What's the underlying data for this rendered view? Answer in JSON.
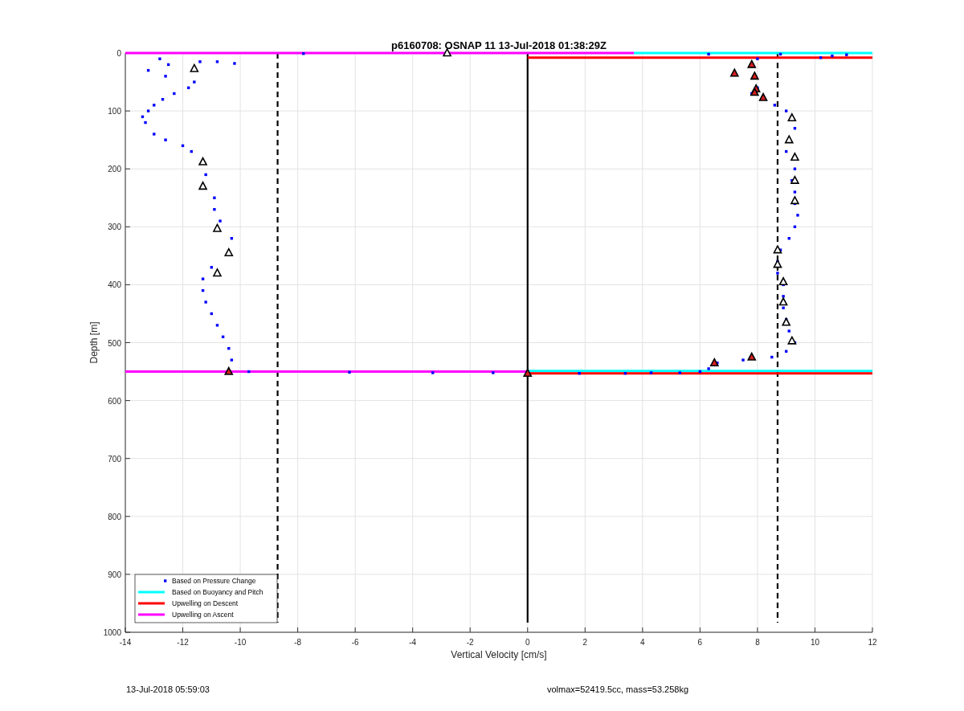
{
  "figure": {
    "chart_data": {
      "type": "scatter",
      "title": "p6160708: OSNAP 11 13-Jul-2018 01:38:29Z",
      "xlabel": "Vertical Velocity [cm/s]",
      "ylabel": "Depth [m]",
      "xlim": [
        -14,
        12
      ],
      "ylim": [
        1000,
        0
      ],
      "xticks": [
        -14,
        -12,
        -10,
        -8,
        -6,
        -4,
        -2,
        0,
        2,
        4,
        6,
        8,
        10,
        12
      ],
      "yticks": [
        0,
        100,
        200,
        300,
        400,
        500,
        600,
        700,
        800,
        900,
        1000
      ],
      "series": [
        {
          "name": "Based on Pressure Change",
          "color": "#0000ff",
          "x": [
            8,
            8,
            7.8,
            8.6,
            9,
            9.3,
            9,
            9.3,
            9.2,
            9.3,
            9.3,
            9.4,
            9.3,
            9.1,
            8.8,
            8.7,
            8.7,
            8.9,
            8.9,
            8.9,
            9,
            9.1,
            9.3,
            9,
            8.5,
            7.5,
            6.6,
            6.3,
            6,
            5.3,
            4.3,
            3.4,
            1.8,
            10.6,
            10.2,
            11.1,
            8.8,
            6.3,
            -10.3,
            -10.4,
            -10.6,
            -10.8,
            -11,
            -11.2,
            -11.3,
            -11.3,
            -11,
            -10.3,
            -10.7,
            -10.9,
            -10.9,
            -11.2,
            -11.7,
            -12,
            -12.6,
            -13,
            -13.3,
            -13.4,
            -13.2,
            -13,
            -12.7,
            -12.3,
            -11.8,
            -11.6,
            -12.6,
            -13.2,
            -12.5,
            -12.8,
            -11.4,
            -10.2,
            -10.8,
            -9.7,
            -6.2,
            -3.3,
            -1.2,
            -7.8
          ],
          "values": [
            10,
            60,
            70,
            90,
            100,
            130,
            170,
            200,
            220,
            240,
            260,
            280,
            300,
            320,
            340,
            360,
            380,
            400,
            420,
            440,
            460,
            480,
            500,
            515,
            525,
            530,
            535,
            545,
            550,
            552,
            552,
            553,
            553,
            5,
            8,
            3,
            2,
            2,
            530,
            510,
            490,
            470,
            450,
            430,
            410,
            390,
            370,
            320,
            290,
            270,
            250,
            210,
            170,
            160,
            150,
            140,
            120,
            110,
            100,
            90,
            80,
            70,
            60,
            50,
            40,
            30,
            20,
            10,
            15,
            18,
            15,
            550,
            551,
            552,
            552,
            1
          ]
        },
        {
          "name": "Based on Buoyancy and Pitch",
          "type": "line",
          "color": "#00ffff",
          "x": [
            3.7,
            12
          ],
          "values": [
            0,
            0
          ]
        },
        {
          "name": "Upwelling on Descent",
          "type": "line",
          "color": "#ff0000",
          "x": [
            0,
            12
          ],
          "values": [
            8,
            8
          ]
        },
        {
          "name": "Upwelling on Ascent",
          "type": "line",
          "color": "#ff00ff",
          "x": [
            -14,
            3.7
          ],
          "values": [
            0,
            0
          ]
        },
        {
          "type": "line",
          "color": "#00ffff",
          "x": [
            0,
            12
          ],
          "values": [
            549,
            549
          ]
        },
        {
          "type": "line",
          "color": "#ff0000",
          "x": [
            0,
            12
          ],
          "values": [
            553,
            553
          ]
        },
        {
          "type": "line",
          "color": "#ff00ff",
          "x": [
            -14,
            0
          ],
          "values": [
            550,
            550
          ]
        },
        {
          "color": "#d62020",
          "x": [
            7.8,
            7.2,
            7.9,
            7.95,
            7.9,
            8.2,
            7.8,
            6.5,
            0,
            -10.4
          ],
          "values": [
            20,
            35,
            40,
            62,
            68,
            77,
            525,
            535,
            553,
            550
          ]
        },
        {
          "color": "#ffffff",
          "x": [
            -11.6,
            -11.3,
            -11.3,
            -10.8,
            -10.4,
            -10.8,
            -2.8,
            9.2,
            9.1,
            9.3,
            9.3,
            9.3,
            8.7,
            8.7,
            8.9,
            8.9,
            9,
            9.2
          ],
          "values": [
            27,
            188,
            230,
            303,
            345,
            380,
            0,
            112,
            150,
            180,
            220,
            255,
            340,
            365,
            395,
            430,
            465,
            497
          ]
        }
      ],
      "grid": true,
      "legend": true,
      "ref_lines": [
        {
          "axis": "x",
          "value": -8.7
        },
        {
          "axis": "x",
          "value": 8.7
        },
        {
          "axis": "x",
          "value": 0
        }
      ]
    },
    "footer_left": "13-Jul-2018 05:59:03",
    "footer_right": "volmax=52419.5cc, mass=53.258kg"
  }
}
